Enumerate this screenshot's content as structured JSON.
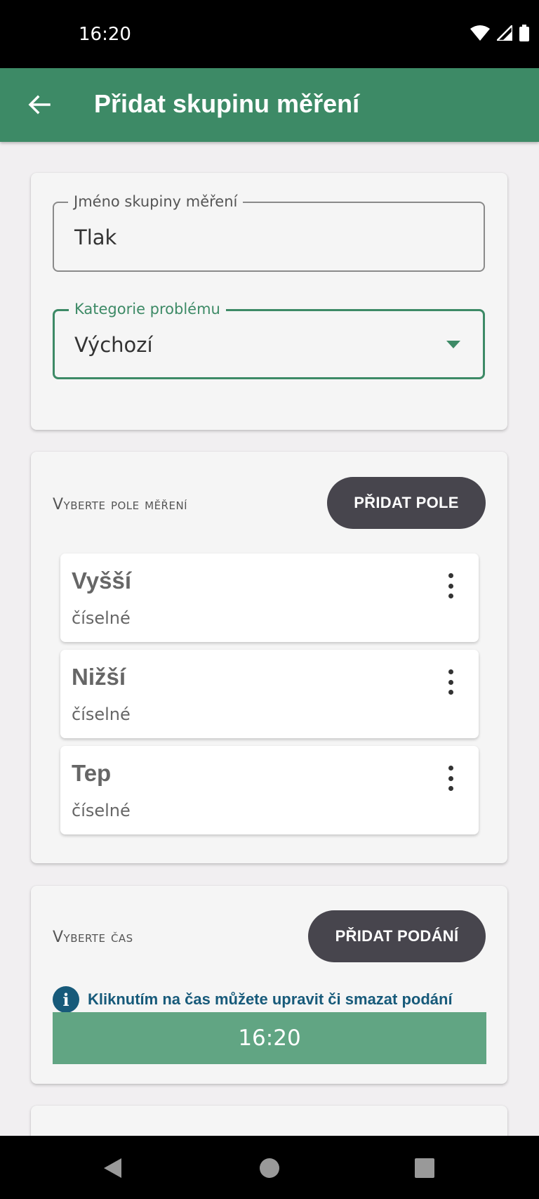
{
  "status": {
    "time": "16:20"
  },
  "app_bar": {
    "title": "Přidat skupinu měření"
  },
  "group_name": {
    "label": "Jméno skupiny měření",
    "value": "Tlak"
  },
  "category": {
    "label": "Kategorie problému",
    "value": "Výchozí"
  },
  "fields_section": {
    "title": "Vyberte pole měření",
    "add_button": "PŘIDAT POLE",
    "items": [
      {
        "name": "Vyšší",
        "type": "číselné"
      },
      {
        "name": "Nižší",
        "type": "číselné"
      },
      {
        "name": "Tep",
        "type": "číselné"
      }
    ]
  },
  "time_section": {
    "title": "Vyberte čas",
    "add_button": "PŘIDAT PODÁNÍ",
    "info_text": "Kliknutím na čas můžete upravit či smazat podání",
    "times": [
      "16:20"
    ]
  },
  "colors": {
    "primary": "#3d8a66",
    "time_bar": "#61a583",
    "button": "#47454d",
    "info": "#175a7a"
  }
}
